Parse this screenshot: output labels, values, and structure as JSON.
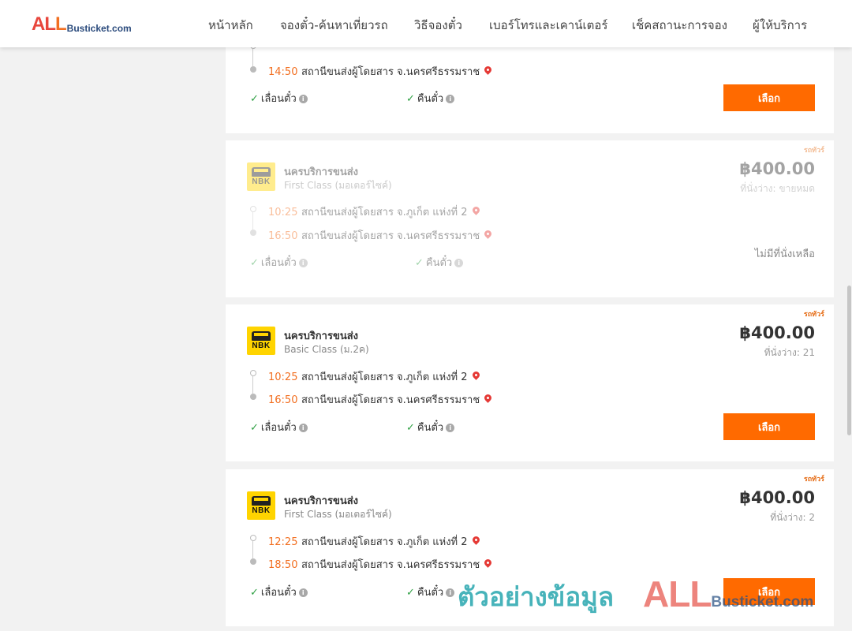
{
  "brand": {
    "logo_part1": "AL",
    "logo_part2": "L",
    "logo_small": "Busticket.com"
  },
  "nav": [
    {
      "label": "หน้าหลัก"
    },
    {
      "label": "จองตั๋ว-ค้นหาเที่ยวรถ"
    },
    {
      "label": "วิธีจองตั๋ว"
    },
    {
      "label": "เบอร์โทรและเคาน์เตอร์"
    },
    {
      "label": "เช็คสถานะการจอง"
    },
    {
      "label": "ผู้ให้บริการ"
    }
  ],
  "common": {
    "select_label": "เลือก",
    "feature_change": "เลื่อนตั๋ว",
    "feature_refund": "คืนตั๋ว",
    "tag": "รถทัวร์",
    "info_glyph": "i",
    "check_glyph": "✓"
  },
  "cards": [
    {
      "partial": true,
      "arrive_time": "14:50",
      "arrive_station": "สถานีขนส่งผู้โดยสาร จ.นครศรีธรรมราช"
    },
    {
      "operator": "นครบริการขนส่ง",
      "operator_logo": "NBK",
      "class": "First Class (มอเตอร์ไซค์)",
      "price": "฿400.00",
      "seats": "ที่นั่งว่าง: ขายหมด",
      "depart_time": "10:25",
      "depart_station": "สถานีขนส่งผู้โดยสาร จ.ภูเก็ต แห่งที่ 2",
      "arrive_time": "16:50",
      "arrive_station": "สถานีขนส่งผู้โดยสาร จ.นครศรีธรรมราช",
      "sold_out_text": "ไม่มีที่นั่งเหลือ"
    },
    {
      "operator": "นครบริการขนส่ง",
      "operator_logo": "NBK",
      "class": "Basic Class (ม.2ค)",
      "price": "฿400.00",
      "seats": "ที่นั่งว่าง: 21",
      "depart_time": "10:25",
      "depart_station": "สถานีขนส่งผู้โดยสาร จ.ภูเก็ต แห่งที่ 2",
      "arrive_time": "16:50",
      "arrive_station": "สถานีขนส่งผู้โดยสาร จ.นครศรีธรรมราช"
    },
    {
      "operator": "นครบริการขนส่ง",
      "operator_logo": "NBK",
      "class": "First Class (มอเตอร์ไซค์)",
      "price": "฿400.00",
      "seats": "ที่นั่งว่าง: 2",
      "depart_time": "12:25",
      "depart_station": "สถานีขนส่งผู้โดยสาร จ.ภูเก็ต แห่งที่ 2",
      "arrive_time": "18:50",
      "arrive_station": "สถานีขนส่งผู้โดยสาร จ.นครศรีธรรมราช"
    }
  ],
  "watermark": {
    "text": "ตัวอย่างข้อมูล",
    "logo_big": "ALL",
    "logo_small": "Busticket.com"
  }
}
